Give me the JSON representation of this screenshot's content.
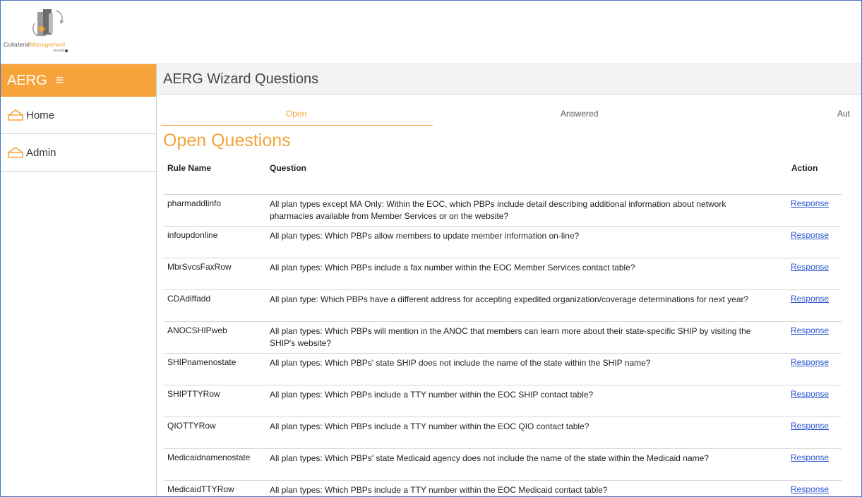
{
  "logo": {
    "brand_part1": "Collateral",
    "brand_part2": "Management",
    "module": "module"
  },
  "sidebar": {
    "header": "AERG",
    "hamburger_glyph": "≡",
    "items": [
      {
        "label": "Home",
        "icon": "house-icon"
      },
      {
        "label": "Admin",
        "icon": "house-icon"
      }
    ]
  },
  "main": {
    "title": "AERG Wizard Questions",
    "tabs": [
      {
        "label": "Open",
        "active": true
      },
      {
        "label": "Answered",
        "active": false
      },
      {
        "label": "Aut",
        "active": false
      }
    ],
    "section_title": "Open Questions"
  },
  "table": {
    "columns": [
      "Rule Name",
      "Question",
      "Action"
    ],
    "rows": [
      {
        "rule": "pharmaddlinfo",
        "question": "All plan types except MA Only: Within the EOC, which PBPs include detail describing additional information about network pharmacies available from Member Services or on the website?",
        "action": "Response"
      },
      {
        "rule": "infoupdonline",
        "question": "All plan types: Which PBPs allow members to update member information on-line?",
        "action": "Response"
      },
      {
        "rule": "MbrSvcsFaxRow",
        "question": "All plan types: Which PBPs include a fax number within the EOC Member Services contact table?",
        "action": "Response"
      },
      {
        "rule": "CDAdiffadd",
        "question": "All plan type: Which PBPs have a different address for accepting expedited organization/coverage determinations for next year?",
        "action": "Response"
      },
      {
        "rule": "ANOCSHIPweb",
        "question": "All plan types: Which PBPs will mention in the ANOC that members can learn more about their state-specific SHIP by visiting the SHIP's website?",
        "action": "Response"
      },
      {
        "rule": "SHIPnamenostate",
        "question": "All plan types: Which PBPs' state SHIP does not include the name of the state within the SHIP name?",
        "action": "Response"
      },
      {
        "rule": "SHIPTTYRow",
        "question": "All plan types: Which PBPs include a TTY number within the EOC SHIP contact table?",
        "action": "Response"
      },
      {
        "rule": "QIOTTYRow",
        "question": "All plan types: Which PBPs include a TTY number within the EOC QIO contact table?",
        "action": "Response"
      },
      {
        "rule": "Medicaidnamenostate",
        "question": "All plan types: Which PBPs' state Medicaid agency does not include the name of the state within the Medicaid name?",
        "action": "Response"
      },
      {
        "rule": "MedicaidTTYRow",
        "question": "All plan types: Which PBPs include a TTY number within the EOC Medicaid contact table?",
        "action": "Response"
      }
    ]
  },
  "colors": {
    "accent": "#f5a33a",
    "link": "#2a55d0",
    "frame": "#4a78c2"
  }
}
